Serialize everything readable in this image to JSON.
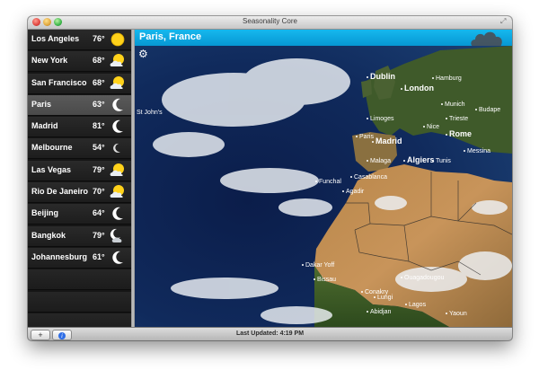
{
  "window": {
    "title": "Seasonality Core"
  },
  "sidebar": {
    "items": [
      {
        "name": "Los Angeles",
        "temp": "76°",
        "icon": "sun-icon"
      },
      {
        "name": "New York",
        "temp": "68°",
        "icon": "sun-cloud-icon"
      },
      {
        "name": "San Francisco",
        "temp": "68°",
        "icon": "sun-cloud-icon"
      },
      {
        "name": "Paris",
        "temp": "63°",
        "icon": "moon-icon",
        "selected": true
      },
      {
        "name": "Madrid",
        "temp": "81°",
        "icon": "moon-icon"
      },
      {
        "name": "Melbourne",
        "temp": "54°",
        "icon": "thin-moon-icon"
      },
      {
        "name": "Las Vegas",
        "temp": "79°",
        "icon": "sun-cloud-icon"
      },
      {
        "name": "Rio De Janeiro",
        "temp": "70°",
        "icon": "sun-cloud-icon"
      },
      {
        "name": "Beijing",
        "temp": "64°",
        "icon": "moon-icon"
      },
      {
        "name": "Bangkok",
        "temp": "79°",
        "icon": "moon-cloud-icon"
      },
      {
        "name": "Johannesburg",
        "temp": "61°",
        "icon": "moon-icon"
      }
    ]
  },
  "main": {
    "location": "Paris, France"
  },
  "map_labels": [
    "Dublin",
    "London",
    "Hamburg",
    "Paris",
    "Munich",
    "Budape",
    "Madrid",
    "Nice",
    "Rome",
    "Messina",
    "Malaga",
    "Algiers",
    "Tunis",
    "Casablanca",
    "Funchal",
    "Agadir",
    "Dakar Yoff",
    "Bissau",
    "Conakry",
    "Lungi",
    "Abidjan",
    "Lagos",
    "Yaoun",
    "St John's",
    "Ouagadougou",
    "Limoges",
    "Trieste"
  ],
  "footer": {
    "add_label": "+",
    "info_label": "i",
    "status": "Last Updated: 4:19 PM"
  },
  "colors": {
    "accent": "#0aa6e0",
    "sidebar_bg": "#1e1e1e",
    "selected_row": "#4e4e4e"
  }
}
